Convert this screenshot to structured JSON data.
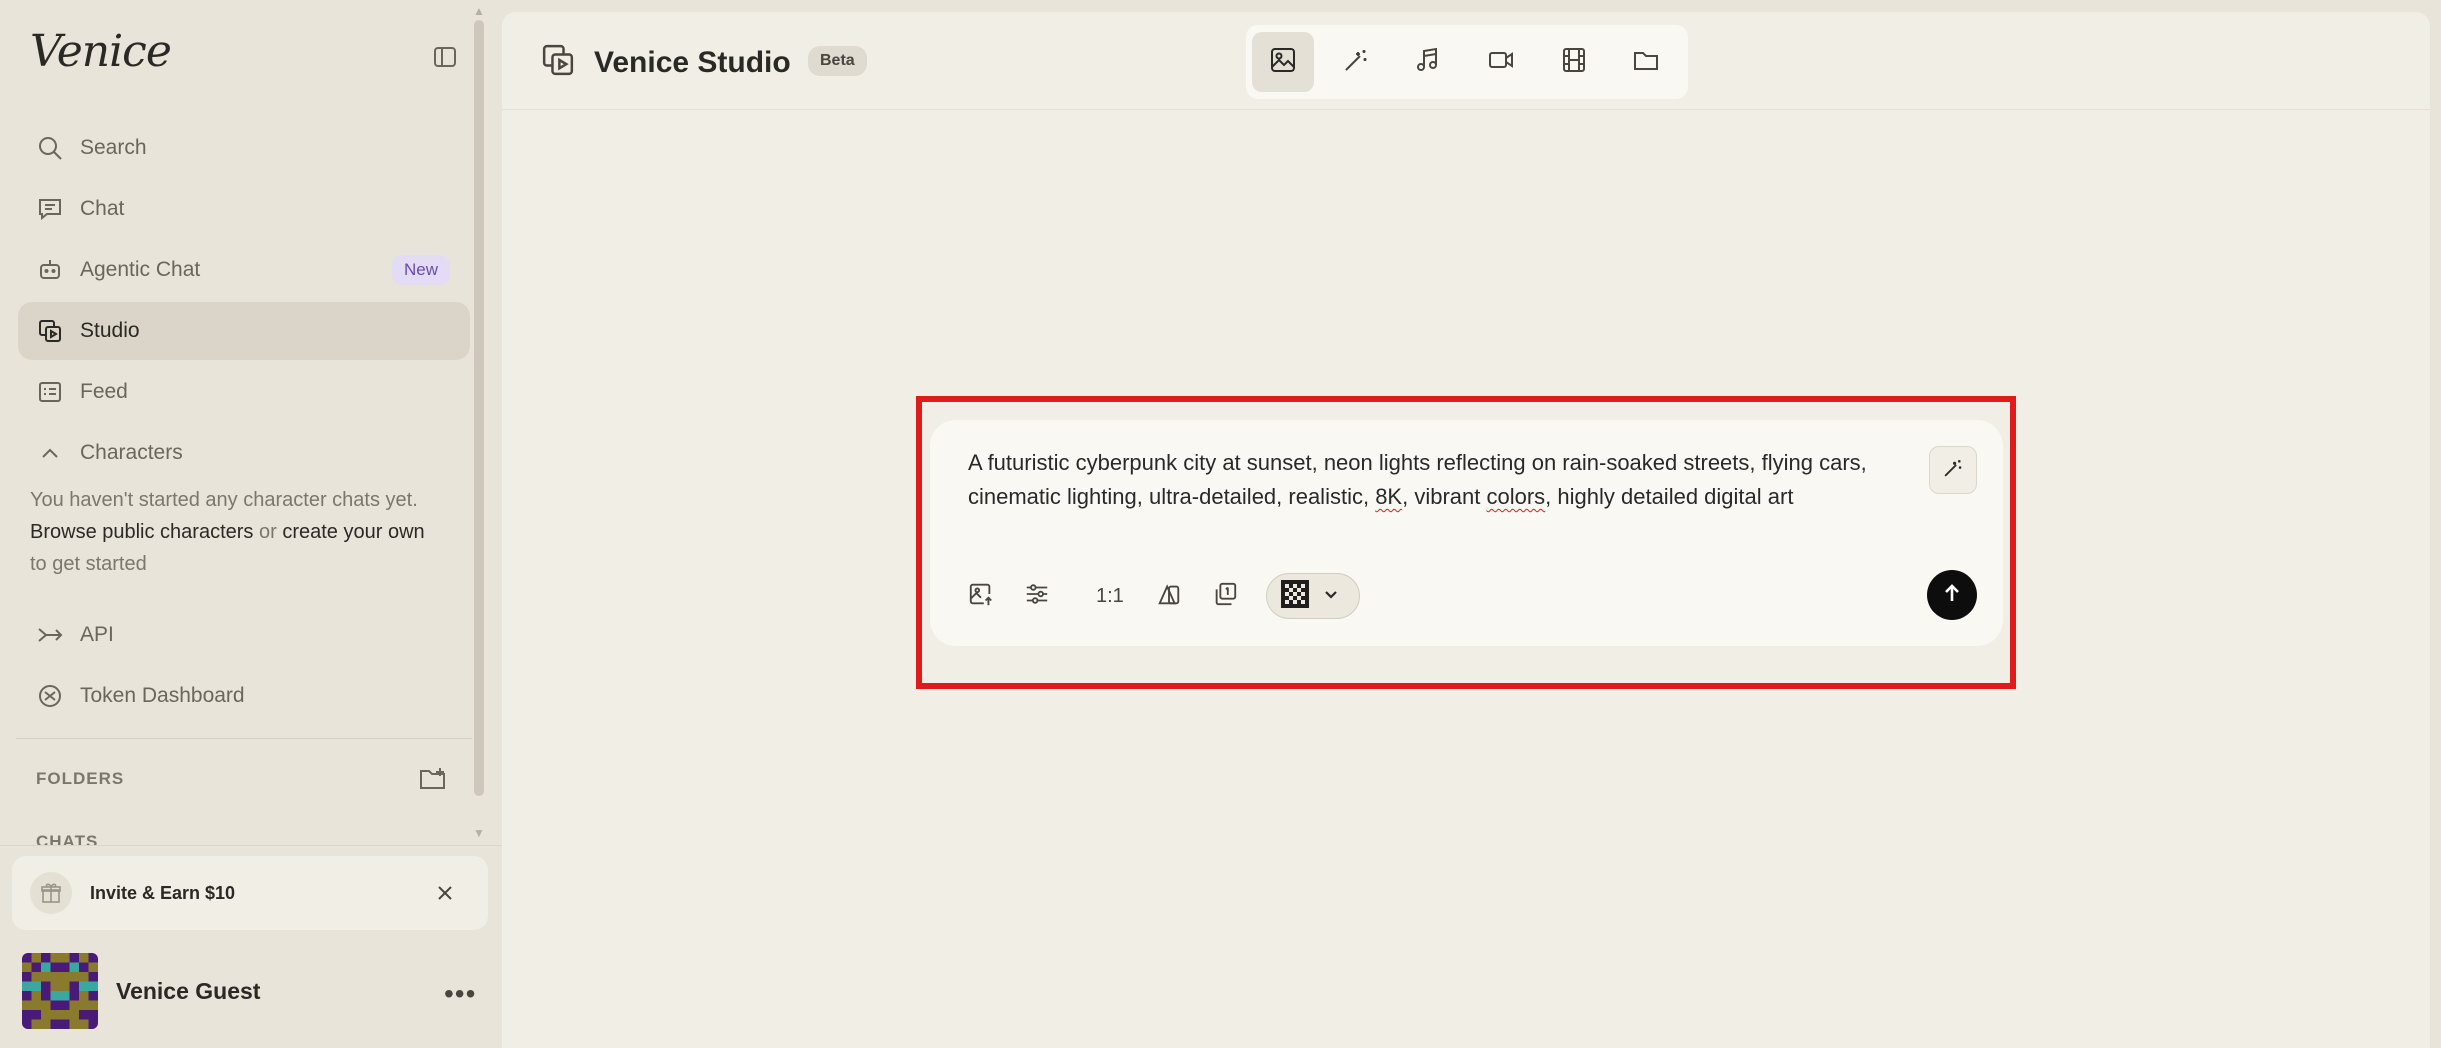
{
  "sidebar": {
    "logo": "Venice",
    "nav": [
      {
        "label": "Search",
        "icon": "search-icon"
      },
      {
        "label": "Chat",
        "icon": "chat-icon"
      },
      {
        "label": "Agentic Chat",
        "icon": "robot-icon",
        "badge": "New"
      },
      {
        "label": "Studio",
        "icon": "studio-icon",
        "active": true
      },
      {
        "label": "Feed",
        "icon": "feed-icon"
      },
      {
        "label": "Characters",
        "icon": "chevron-up-icon"
      }
    ],
    "characters_empty": {
      "line1": "You haven't started any character chats yet.",
      "browse": "Browse public characters",
      "or": " or ",
      "create": "create your own",
      "end": "to get started"
    },
    "api": "API",
    "token_dashboard": "Token Dashboard",
    "folders_label": "FOLDERS",
    "chats_label": "CHATS",
    "invite": "Invite & Earn $10",
    "user_name": "Venice Guest"
  },
  "main": {
    "title": "Venice Studio",
    "badge": "Beta",
    "modes": [
      "image-icon",
      "magic-wand-icon",
      "music-icon",
      "video-camera-icon",
      "film-icon",
      "folder-icon"
    ],
    "prompt": {
      "text_before": "A futuristic cyberpunk city at sunset, neon lights reflecting on rain-soaked streets, flying cars, cinematic lighting, ultra-detailed, realistic, ",
      "word_8k": "8K",
      "text_mid": ", vibrant ",
      "word_colors": "colors",
      "text_after": ", highly detailed digital art",
      "ratio": "1:1"
    }
  },
  "colors": {
    "highlight": "#e01b1b",
    "new_badge_bg": "#e4dcf5",
    "new_badge_text": "#6b4bb0",
    "send_button": "#0d0d0d"
  }
}
